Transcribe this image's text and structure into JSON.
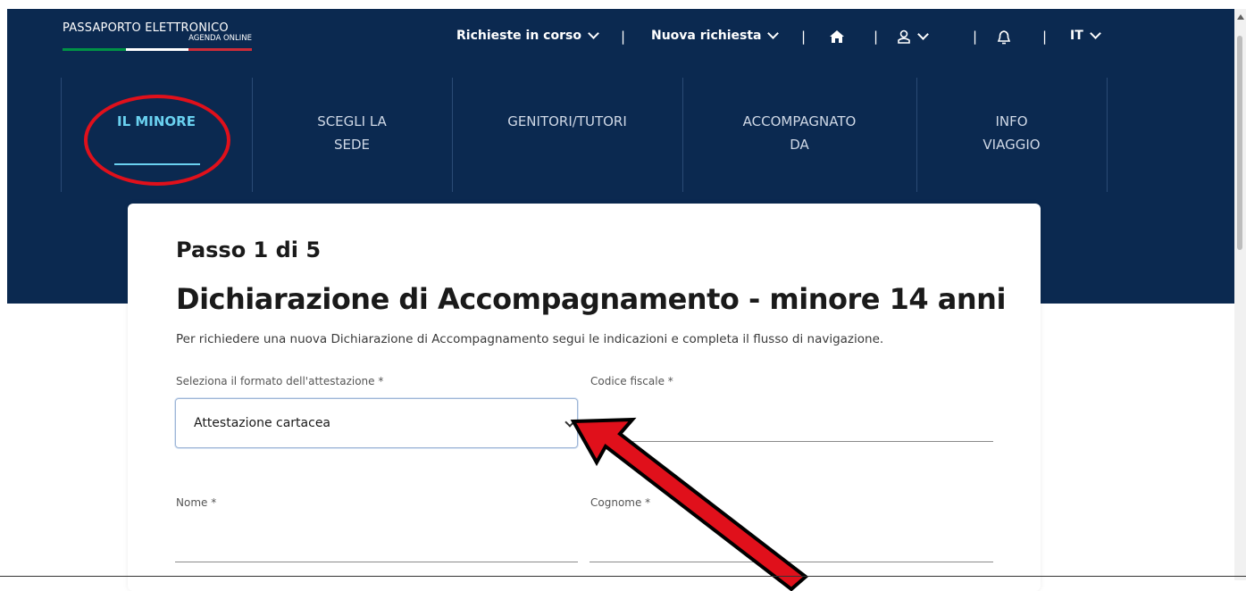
{
  "header": {
    "logo_title": "PASSAPORTO ELETTRONICO",
    "logo_subtitle": "AGENDA ONLINE",
    "flag_colors": [
      "#009246",
      "#ffffff",
      "#ce2b37"
    ],
    "nav": {
      "richieste": "Richieste in corso",
      "nuova": "Nuova richiesta",
      "separator": "|",
      "language": "IT"
    },
    "icons": [
      "home-icon",
      "user-icon",
      "bell-icon"
    ]
  },
  "steps": [
    {
      "line1": "IL MINORE",
      "line2": ""
    },
    {
      "line1": "SCEGLI LA",
      "line2": "SEDE"
    },
    {
      "line1": "GENITORI/TUTORI",
      "line2": ""
    },
    {
      "line1": "ACCOMPAGNATO",
      "line2": "DA"
    },
    {
      "line1": "INFO",
      "line2": "VIAGGIO"
    }
  ],
  "form": {
    "step_count": "Passo 1 di 5",
    "title": "Dichiarazione di Accompagnamento - minore 14 anni",
    "intro": "Per richiedere una nuova Dichiarazione di Accompagnamento segui le indicazioni e completa il flusso di navigazione.",
    "format_label": "Seleziona il formato dell'attestazione *",
    "format_value": "Attestazione cartacea",
    "codice_fiscale_label": "Codice fiscale *",
    "nome_label": "Nome *",
    "cognome_label": "Cognome *"
  },
  "colors": {
    "primary_dark": "#0b2950",
    "active_step": "#6ad1f0",
    "annotation_red": "#e0101b"
  }
}
